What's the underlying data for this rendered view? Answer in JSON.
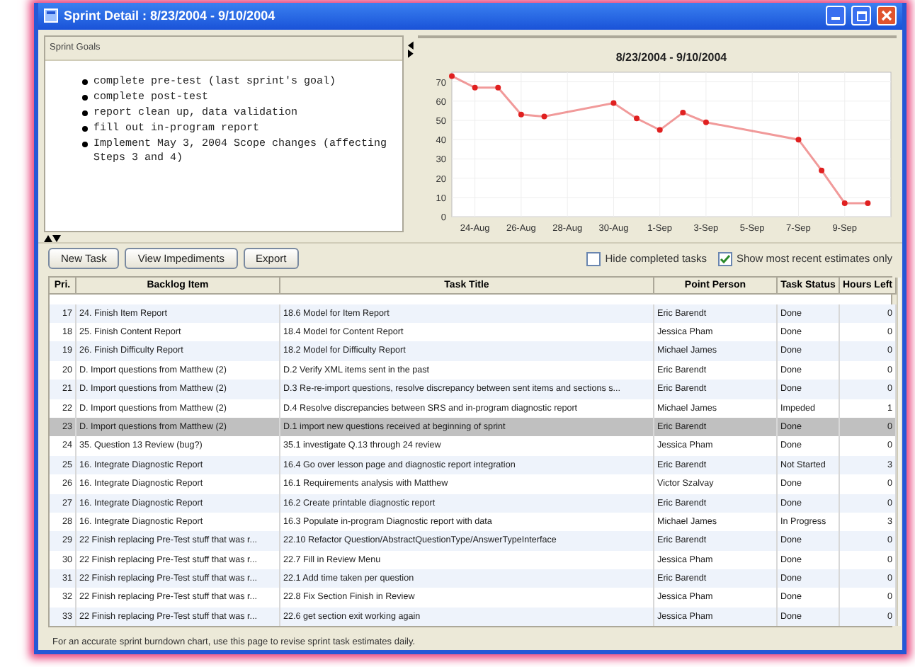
{
  "window": {
    "title": "Sprint Detail : 8/23/2004 - 9/10/2004"
  },
  "goals": {
    "label": "Sprint Goals",
    "items": [
      "complete pre-test (last sprint's goal)",
      "complete post-test",
      "report clean up, data validation",
      "fill out in-program report",
      "Implement May 3, 2004 Scope changes (affecting Steps 3 and 4)"
    ]
  },
  "chart": {
    "chart_data": {
      "type": "line",
      "title": "8/23/2004 - 9/10/2004",
      "categories": [
        null,
        "24-Aug",
        null,
        "26-Aug",
        null,
        "28-Aug",
        null,
        "30-Aug",
        null,
        "1-Sep",
        null,
        "3-Sep",
        null,
        "5-Sep",
        null,
        "7-Sep",
        null,
        "9-Sep",
        null
      ],
      "grid": true,
      "series": [
        {
          "color": "#e02020",
          "marker": true,
          "values": [
            73,
            67,
            67,
            53,
            52,
            null,
            null,
            59,
            51,
            45,
            54,
            49,
            null,
            null,
            null,
            40,
            24,
            7,
            7
          ]
        }
      ],
      "ylim": [
        0,
        75
      ],
      "yticks": [
        0,
        10,
        20,
        30,
        40,
        50,
        60,
        70
      ]
    }
  },
  "toolbar": {
    "buttons": [
      "New Task",
      "View Impediments",
      "Export"
    ],
    "checkboxes": [
      {
        "label": "Hide completed tasks",
        "checked": false
      },
      {
        "label": "Show most recent estimates only",
        "checked": true
      }
    ]
  },
  "table": {
    "columns": [
      "Pri.",
      "Backlog Item",
      "Task Title",
      "Point Person",
      "Task Status",
      "Hours Left"
    ],
    "rows": [
      {
        "cells": [
          "17",
          "24. Finish Item Report",
          "18.6 Model for Item Report",
          "Eric Barendt",
          "Done",
          "0"
        ],
        "selected": false
      },
      {
        "cells": [
          "18",
          "25. Finish Content Report",
          "18.4 Model for Content Report",
          "Jessica Pham",
          "Done",
          "0"
        ],
        "selected": false
      },
      {
        "cells": [
          "19",
          "26. Finish Difficulty Report",
          "18.2 Model for Difficulty Report",
          "Michael James",
          "Done",
          "0"
        ],
        "selected": false
      },
      {
        "cells": [
          "20",
          "D. Import questions from Matthew (2)",
          "D.2 Verify XML items sent in the past",
          "Eric Barendt",
          "Done",
          "0"
        ],
        "selected": false
      },
      {
        "cells": [
          "21",
          "D. Import questions from Matthew (2)",
          "D.3 Re-re-import questions, resolve discrepancy between sent items and sections s...",
          "Eric Barendt",
          "Done",
          "0"
        ],
        "selected": false
      },
      {
        "cells": [
          "22",
          "D. Import questions from Matthew (2)",
          "D.4 Resolve discrepancies between SRS and in-program diagnostic report",
          "Michael James",
          "Impeded",
          "1"
        ],
        "selected": false
      },
      {
        "cells": [
          "23",
          "D. Import questions from Matthew (2)",
          "D.1 import new questions received at beginning of sprint",
          "Eric Barendt",
          "Done",
          "0"
        ],
        "selected": true
      },
      {
        "cells": [
          "24",
          "35. Question 13 Review (bug?)",
          "35.1 investigate Q.13 through 24 review",
          "Jessica Pham",
          "Done",
          "0"
        ],
        "selected": false
      },
      {
        "cells": [
          "25",
          "16. Integrate Diagnostic Report",
          "16.4 Go over lesson page and diagnostic report integration",
          "Eric Barendt",
          "Not Started",
          "3"
        ],
        "selected": false
      },
      {
        "cells": [
          "26",
          "16. Integrate Diagnostic Report",
          "16.1 Requirements analysis with Matthew",
          "Victor Szalvay",
          "Done",
          "0"
        ],
        "selected": false
      },
      {
        "cells": [
          "27",
          "16. Integrate Diagnostic Report",
          "16.2 Create printable diagnostic report",
          "Eric Barendt",
          "Done",
          "0"
        ],
        "selected": false
      },
      {
        "cells": [
          "28",
          "16. Integrate Diagnostic Report",
          "16.3 Populate in-program Diagnostic report with data",
          "Michael James",
          "In Progress",
          "3"
        ],
        "selected": false
      },
      {
        "cells": [
          "29",
          "22 Finish replacing Pre-Test stuff that was r...",
          "22.10 Refactor Question/AbstractQuestionType/AnswerTypeInterface",
          "Eric Barendt",
          "Done",
          "0"
        ],
        "selected": false
      },
      {
        "cells": [
          "30",
          "22 Finish replacing Pre-Test stuff that was r...",
          "22.7 Fill in Review Menu",
          "Jessica Pham",
          "Done",
          "0"
        ],
        "selected": false
      },
      {
        "cells": [
          "31",
          "22 Finish replacing Pre-Test stuff that was r...",
          "22.1 Add time taken per question",
          "Eric Barendt",
          "Done",
          "0"
        ],
        "selected": false
      },
      {
        "cells": [
          "32",
          "22 Finish replacing Pre-Test stuff that was r...",
          "22.8 Fix Section Finish in Review",
          "Jessica Pham",
          "Done",
          "0"
        ],
        "selected": false
      },
      {
        "cells": [
          "33",
          "22 Finish replacing Pre-Test stuff that was r...",
          "22.6 get section exit working again",
          "Jessica Pham",
          "Done",
          "0"
        ],
        "selected": false
      }
    ]
  },
  "status_bar": "For an accurate sprint burndown chart, use this page to revise sprint task estimates daily."
}
